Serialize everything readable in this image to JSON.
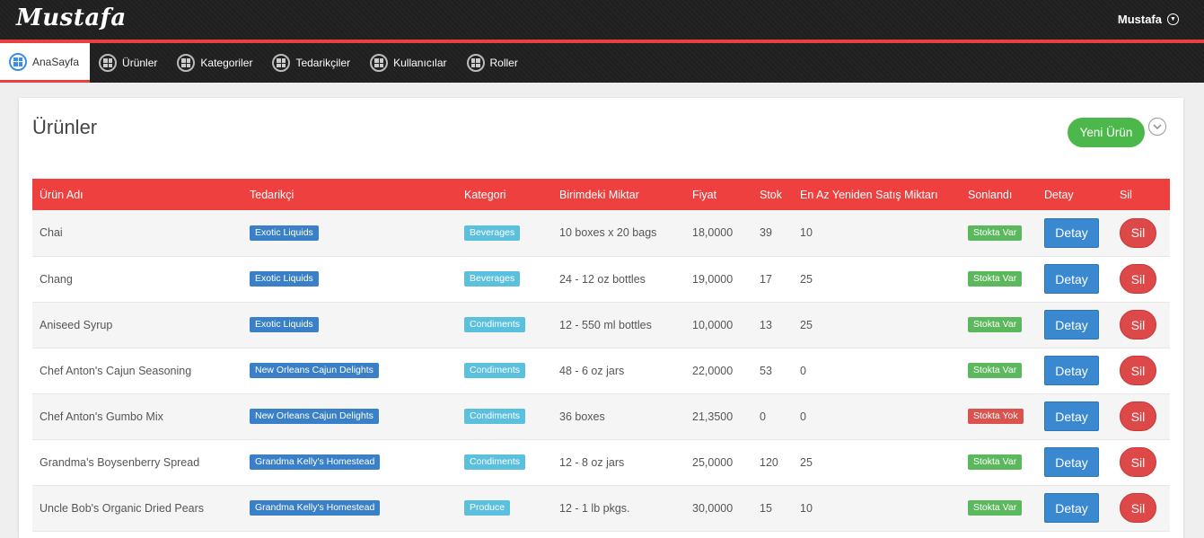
{
  "header": {
    "brand": "Mustafa",
    "user_name": "Mustafa"
  },
  "nav": [
    {
      "label": "AnaSayfa",
      "active": true
    },
    {
      "label": "Ürünler",
      "active": false
    },
    {
      "label": "Kategoriler",
      "active": false
    },
    {
      "label": "Tedarikçiler",
      "active": false
    },
    {
      "label": "Kullanıcılar",
      "active": false
    },
    {
      "label": "Roller",
      "active": false
    }
  ],
  "page": {
    "title": "Ürünler",
    "new_button": "Yeni Ürün"
  },
  "table": {
    "columns": [
      "Ürün Adı",
      "Tedarikçi",
      "Kategori",
      "Birimdeki Miktar",
      "Fiyat",
      "Stok",
      "En Az Yeniden Satış Miktarı",
      "Sonlandı",
      "Detay",
      "Sil"
    ],
    "rows": [
      {
        "name": "Chai",
        "supplier": "Exotic Liquids",
        "category": "Beverages",
        "unit": "10 boxes x 20 bags",
        "price": "18,0000",
        "stock": "39",
        "reorder": "10",
        "status": "Stokta Var",
        "in_stock": true,
        "detay": "Detay",
        "sil": "Sil"
      },
      {
        "name": "Chang",
        "supplier": "Exotic Liquids",
        "category": "Beverages",
        "unit": "24 - 12 oz bottles",
        "price": "19,0000",
        "stock": "17",
        "reorder": "25",
        "status": "Stokta Var",
        "in_stock": true,
        "detay": "Detay",
        "sil": "Sil"
      },
      {
        "name": "Aniseed Syrup",
        "supplier": "Exotic Liquids",
        "category": "Condiments",
        "unit": "12 - 550 ml bottles",
        "price": "10,0000",
        "stock": "13",
        "reorder": "25",
        "status": "Stokta Var",
        "in_stock": true,
        "detay": "Detay",
        "sil": "Sil"
      },
      {
        "name": "Chef Anton's Cajun Seasoning",
        "supplier": "New Orleans Cajun Delights",
        "category": "Condiments",
        "unit": "48 - 6 oz jars",
        "price": "22,0000",
        "stock": "53",
        "reorder": "0",
        "status": "Stokta Var",
        "in_stock": true,
        "detay": "Detay",
        "sil": "Sil"
      },
      {
        "name": "Chef Anton's Gumbo Mix",
        "supplier": "New Orleans Cajun Delights",
        "category": "Condiments",
        "unit": "36 boxes",
        "price": "21,3500",
        "stock": "0",
        "reorder": "0",
        "status": "Stokta Yok",
        "in_stock": false,
        "detay": "Detay",
        "sil": "Sil"
      },
      {
        "name": "Grandma's Boysenberry Spread",
        "supplier": "Grandma Kelly's Homestead",
        "category": "Condiments",
        "unit": "12 - 8 oz jars",
        "price": "25,0000",
        "stock": "120",
        "reorder": "25",
        "status": "Stokta Var",
        "in_stock": true,
        "detay": "Detay",
        "sil": "Sil"
      },
      {
        "name": "Uncle Bob's Organic Dried Pears",
        "supplier": "Grandma Kelly's Homestead",
        "category": "Produce",
        "unit": "12 - 1 lb pkgs.",
        "price": "30,0000",
        "stock": "15",
        "reorder": "10",
        "status": "Stokta Var",
        "in_stock": true,
        "detay": "Detay",
        "sil": "Sil"
      }
    ]
  }
}
